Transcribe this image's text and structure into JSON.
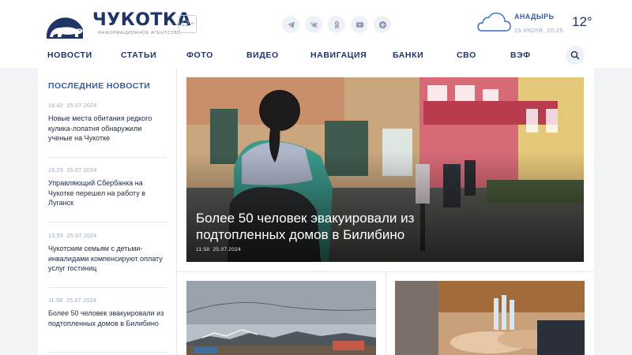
{
  "brand": {
    "name": "ЧУКОТКА",
    "subtitle": "Информационное агентство",
    "age_rating": "12+"
  },
  "social": [
    "telegram-icon",
    "vk-icon",
    "odnoklassniki-icon",
    "youtube-icon",
    "plus-icon"
  ],
  "weather": {
    "city": "Анадырь",
    "date": "25 июля, 20:25",
    "temperature": "12°"
  },
  "nav": {
    "items": [
      "Новости",
      "Статьи",
      "Фото",
      "Видео",
      "Навигация",
      "Банки",
      "СВО",
      "ВЭФ"
    ]
  },
  "sidebar": {
    "title": "Последние новости",
    "items": [
      {
        "time": "16:42",
        "date": "25.07.2024",
        "title": "Новые места обитания редкого кулика-лопатня обнаружили ученые на Чукотке"
      },
      {
        "time": "15:29",
        "date": "25.07.2024",
        "title": "Управляющий Сбербанка на Чукотке перешел на работу в Луганск"
      },
      {
        "time": "13:55",
        "date": "25.07.2024",
        "title": "Чукотским семьям с детьми-инвалидами компенсируют оплату услуг гостиниц"
      },
      {
        "time": "11:58",
        "date": "25.07.2024",
        "title": "Более 50 человек эвакуировали из подтопленных домов в Билибино"
      }
    ]
  },
  "hero": {
    "title": "Более 50 человек эвакуировали из подтопленных домов в Билибино",
    "time": "11:58",
    "date": "25.07.2024"
  },
  "colors": {
    "brand": "#1f3566",
    "accent": "#3a5da0",
    "background": "#f2f4f7"
  }
}
